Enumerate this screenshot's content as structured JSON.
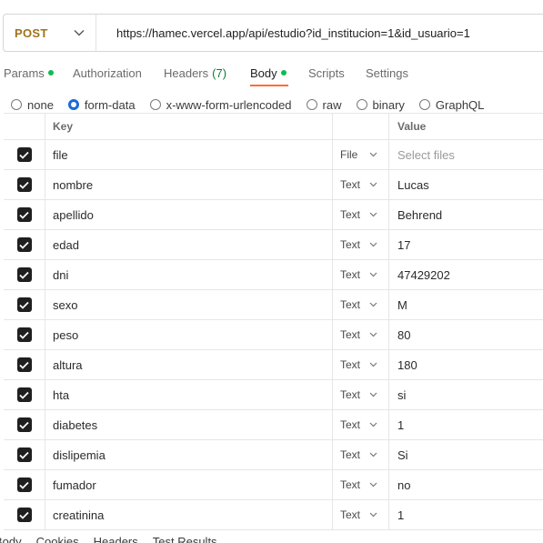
{
  "request": {
    "method": "POST",
    "url": "https://hamec.vercel.app/api/estudio?id_institucion=1&id_usuario=1"
  },
  "tabs": [
    {
      "label": "Params",
      "dot": true
    },
    {
      "label": "Authorization"
    },
    {
      "label": "Headers",
      "count": "(7)"
    },
    {
      "label": "Body",
      "dot": true,
      "active": true
    },
    {
      "label": "Scripts"
    },
    {
      "label": "Settings"
    }
  ],
  "body_types": [
    {
      "label": "none",
      "selected": false
    },
    {
      "label": "form-data",
      "selected": true
    },
    {
      "label": "x-www-form-urlencoded",
      "selected": false
    },
    {
      "label": "raw",
      "selected": false
    },
    {
      "label": "binary",
      "selected": false
    },
    {
      "label": "GraphQL",
      "selected": false
    }
  ],
  "table": {
    "key_header": "Key",
    "value_header": "Value",
    "rows": [
      {
        "key": "file",
        "type": "File",
        "value": "",
        "placeholder": "Select files"
      },
      {
        "key": "nombre",
        "type": "Text",
        "value": "Lucas"
      },
      {
        "key": "apellido",
        "type": "Text",
        "value": "Behrend"
      },
      {
        "key": "edad",
        "type": "Text",
        "value": "17"
      },
      {
        "key": "dni",
        "type": "Text",
        "value": "47429202"
      },
      {
        "key": "sexo",
        "type": "Text",
        "value": "M"
      },
      {
        "key": "peso",
        "type": "Text",
        "value": "80"
      },
      {
        "key": "altura",
        "type": "Text",
        "value": "180"
      },
      {
        "key": "hta",
        "type": "Text",
        "value": "si"
      },
      {
        "key": "diabetes",
        "type": "Text",
        "value": "1"
      },
      {
        "key": "dislipemia",
        "type": "Text",
        "value": "Si"
      },
      {
        "key": "fumador",
        "type": "Text",
        "value": "no"
      },
      {
        "key": "creatinina",
        "type": "Text",
        "value": "1"
      }
    ]
  },
  "response_tabs": [
    "Body",
    "Cookies",
    "Headers",
    "Test Results"
  ],
  "icons": {
    "chevron": "chevron-down-icon",
    "check": "check-icon"
  },
  "colors": {
    "method": "#a0731a",
    "accent": "#ff6c37",
    "dot": "#0cbb52",
    "radio": "#1a6bd6"
  }
}
